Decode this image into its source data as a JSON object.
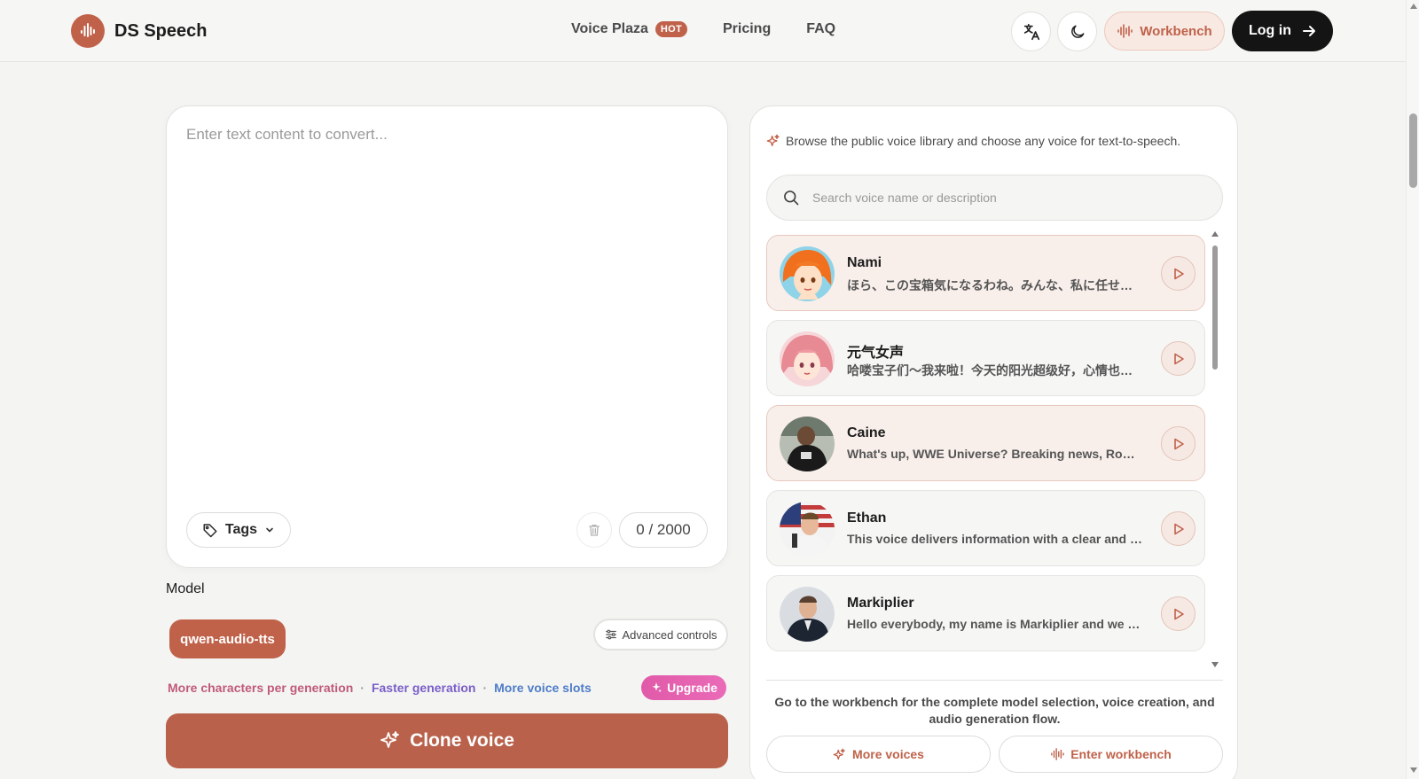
{
  "brand": {
    "name": "DS Speech",
    "accent": "#c0624a"
  },
  "nav": {
    "voice_plaza": "Voice Plaza",
    "hot_badge": "HOT",
    "pricing": "Pricing",
    "faq": "FAQ"
  },
  "header_actions": {
    "translate_icon": "translate-icon",
    "theme_icon": "moon-icon",
    "workbench": "Workbench",
    "login": "Log in"
  },
  "editor": {
    "placeholder": "Enter text content to convert...",
    "value": "",
    "tags_label": "Tags",
    "counter": "0 / 2000"
  },
  "model": {
    "label": "Model",
    "selected": "qwen-audio-tts",
    "advanced_label": "Advanced controls"
  },
  "perks": {
    "items": [
      "More characters per generation",
      "Faster generation",
      "More voice slots"
    ],
    "separator": "·",
    "upgrade": "Upgrade"
  },
  "clone_button": "Clone voice",
  "panel": {
    "hint": "Browse the public voice library and choose any voice for text-to-speech.",
    "search_placeholder": "Search voice name or description",
    "voices": [
      {
        "name": "Nami",
        "desc": "ほら、この宝箱気になるわね。みんな、私に任せなさい！",
        "highlighted": true
      },
      {
        "name": "元气女声",
        "desc": "哈喽宝子们～我来啦！今天的阳光超级好，心情也是美美哒！",
        "highlighted": false
      },
      {
        "name": "Caine",
        "desc": "What's up, WWE Universe? Breaking news, Roman Reigns is back",
        "highlighted": true
      },
      {
        "name": "Ethan",
        "desc": "This voice delivers information with a clear and measured tone",
        "highlighted": false
      },
      {
        "name": "Markiplier",
        "desc": "Hello everybody, my name is Markiplier and we are back",
        "highlighted": false
      }
    ],
    "workbench_note": "Go to the workbench for the complete model selection, voice creation, and audio generation flow.",
    "more_voices": "More voices",
    "enter_workbench": "Enter workbench"
  }
}
